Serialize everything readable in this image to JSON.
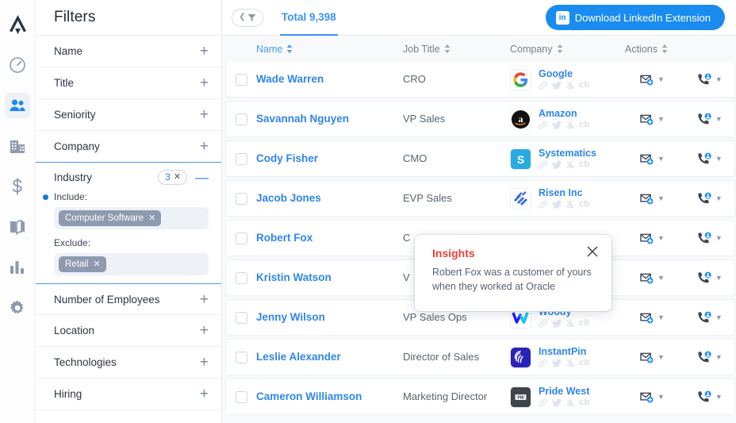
{
  "rail": {
    "logo_icon": "arrow-logo-icon",
    "items": [
      {
        "icon": "speedometer-icon",
        "name": "dashboard",
        "active": false
      },
      {
        "icon": "people-icon",
        "name": "contacts",
        "active": true
      },
      {
        "icon": "building-icon",
        "name": "companies",
        "active": false
      },
      {
        "icon": "dollar-icon",
        "name": "deals",
        "active": false
      },
      {
        "icon": "book-icon",
        "name": "library",
        "active": false
      },
      {
        "icon": "bar-chart-icon",
        "name": "analytics",
        "active": false
      },
      {
        "icon": "gear-icon",
        "name": "settings",
        "active": false
      }
    ]
  },
  "filters": {
    "title": "Filters",
    "sections": [
      {
        "label": "Name",
        "control": "+"
      },
      {
        "label": "Title",
        "control": "+"
      },
      {
        "label": "Seniority",
        "control": "+"
      },
      {
        "label": "Company",
        "control": "+"
      }
    ],
    "industry": {
      "label": "Industry",
      "count": "3",
      "clear_icon": "close-icon",
      "collapse_control": "—",
      "include_label": "Include:",
      "include_tags": [
        "Computer Software"
      ],
      "exclude_label": "Exclude:",
      "exclude_tags": [
        "Retail"
      ],
      "tag_remove_icon": "close-icon"
    },
    "sections_after": [
      {
        "label": "Number of Employees",
        "control": "+"
      },
      {
        "label": "Location",
        "control": "+"
      },
      {
        "label": "Technologies",
        "control": "+"
      },
      {
        "label": "Hiring",
        "control": "+"
      }
    ]
  },
  "topbar": {
    "filter_toggle_icon": "collapse-filter-icon",
    "total_label": "Total 9,398",
    "linkedin_button": "Download LinkedIn Extension",
    "linkedin_badge": "in"
  },
  "table": {
    "columns": [
      {
        "label": "Name",
        "sortable": true,
        "active": true
      },
      {
        "label": "Job Title",
        "sortable": true,
        "active": false
      },
      {
        "label": "Company",
        "sortable": true,
        "active": false
      },
      {
        "label": "Actions",
        "sortable": true,
        "active": false
      }
    ],
    "social_icons": [
      "link-icon",
      "twitter-icon",
      "angellist-icon"
    ],
    "social_text": "cb",
    "action_icons": [
      "email-add-icon",
      "phone-person-icon"
    ],
    "rows": [
      {
        "name": "Wade Warren",
        "title": "CRO",
        "company": "Google",
        "logo": "google"
      },
      {
        "name": "Savannah Nguyen",
        "title": "VP Sales",
        "company": "Amazon",
        "logo": "amazon"
      },
      {
        "name": "Cody Fisher",
        "title": "CMO",
        "company": "Systematics",
        "logo": "systematics"
      },
      {
        "name": "Jacob Jones",
        "title": "EVP Sales",
        "company": "Risen Inc",
        "logo": "risen"
      },
      {
        "name": "Robert Fox",
        "title": "C",
        "company": "",
        "logo": "hidden"
      },
      {
        "name": "Kristin Watson",
        "title": "V",
        "company": "",
        "logo": "hidden"
      },
      {
        "name": "Jenny Wilson",
        "title": "VP Sales Ops",
        "company": "Woody",
        "logo": "woody"
      },
      {
        "name": "Leslie Alexander",
        "title": "Director of Sales",
        "company": "InstantPin",
        "logo": "instantpin"
      },
      {
        "name": "Cameron Williamson",
        "title": "Marketing Director",
        "company": "Pride West",
        "logo": "pridewest"
      }
    ]
  },
  "insights": {
    "title": "Insights",
    "body": "Robert Fox was a customer of yours when they worked at Oracle",
    "close_icon": "close-icon"
  },
  "colors": {
    "accent_blue": "#2f86ea",
    "button_blue": "#1a8cf0",
    "insights_red": "#ef4136",
    "tag_gray": "#8e9aaf",
    "page_bg": "#f7f9fb"
  }
}
